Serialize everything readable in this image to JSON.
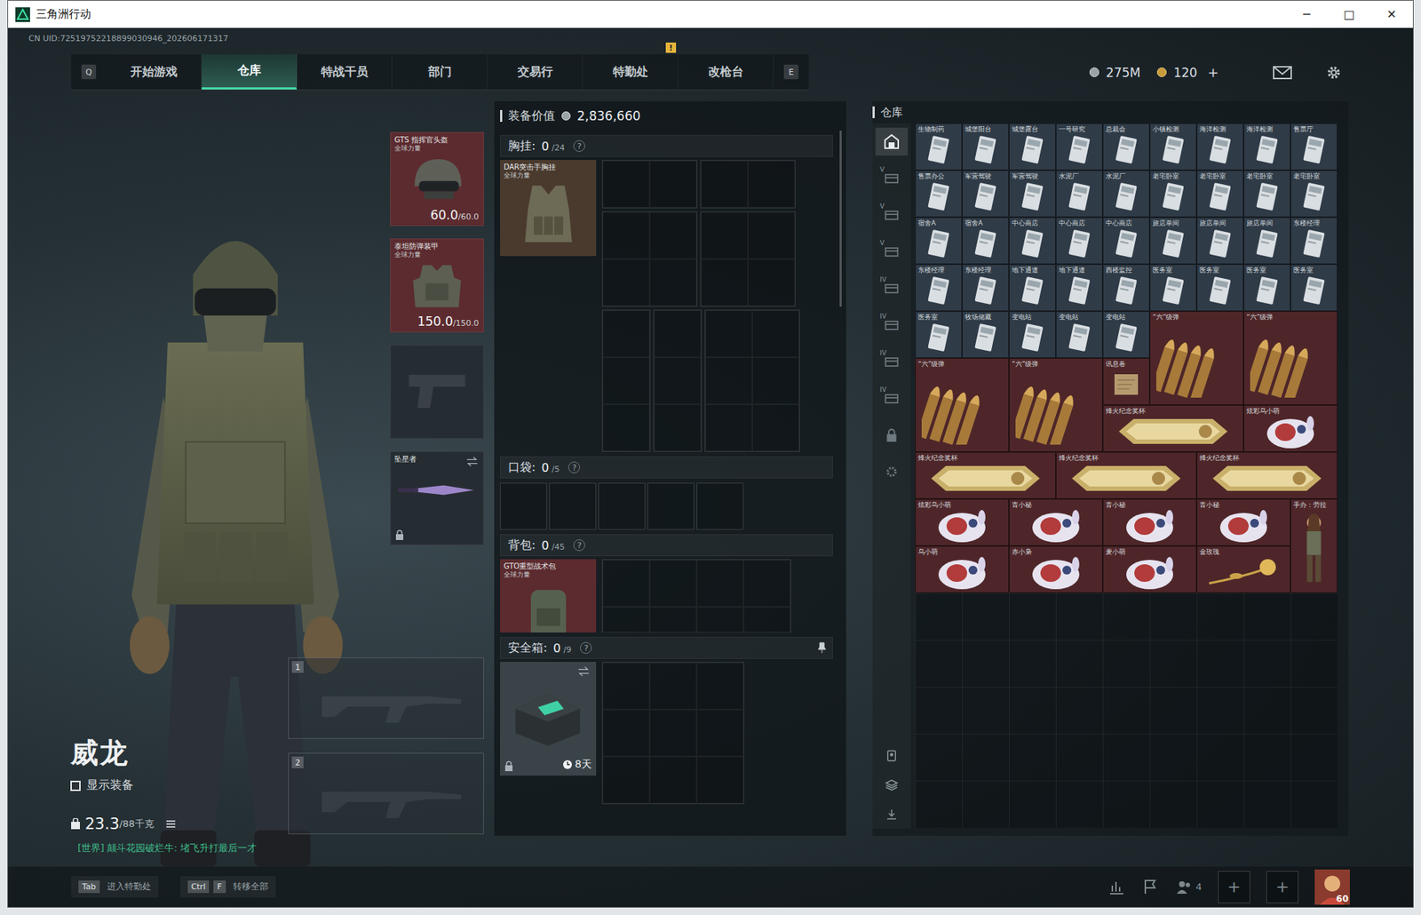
{
  "window": {
    "title": "三角洲行动",
    "controls": [
      "─",
      "□",
      "✕"
    ]
  },
  "uid": "CN UID:72519752218899030946_202606171317",
  "nav": {
    "left_key": "Q",
    "right_key": "E",
    "alert_mark": "!",
    "tabs": [
      {
        "label": "开始游戏",
        "selected": false,
        "alert": false
      },
      {
        "label": "仓库",
        "selected": true,
        "alert": false
      },
      {
        "label": "特战干员",
        "selected": false,
        "alert": false
      },
      {
        "label": "部门",
        "selected": false,
        "alert": false
      },
      {
        "label": "交易行",
        "selected": false,
        "alert": false
      },
      {
        "label": "特勤处",
        "selected": false,
        "alert": true
      },
      {
        "label": "改枪台",
        "selected": false,
        "alert": false
      }
    ]
  },
  "currency": {
    "coins": "275M",
    "tickets": "120",
    "topup": "+"
  },
  "operator": {
    "name": "威龙",
    "show_gear": {
      "label": "显示装备",
      "checked": false
    },
    "weight": "23.3",
    "weight_max": "/88千克",
    "chat": "[世界] 颠斗花园破烂牛: 堵飞升打最后一才"
  },
  "gear_slots": [
    {
      "kind": "helmet",
      "name": "GTS 指挥官头盔",
      "tag": "全球力量",
      "durability": "60.0",
      "max": "/60.0",
      "color": "#5c2b2f",
      "locked": false
    },
    {
      "kind": "armor",
      "name": "泰坦防弹装甲",
      "tag": "全球力量",
      "durability": "150.0",
      "max": "/150.0",
      "color": "#5c2b2f",
      "locked": false
    },
    {
      "kind": "pistol",
      "color": "#262d32",
      "locked": false
    },
    {
      "kind": "melee",
      "name": "坠星者",
      "color": "#262d32",
      "locked": true
    }
  ],
  "weapon_slots": [
    {
      "number": "1"
    },
    {
      "number": "2"
    }
  ],
  "loadout": {
    "value_label": "装备价值",
    "value": "2,836,660",
    "help": "?",
    "sections": [
      {
        "kind": "rig",
        "label": "胸挂:",
        "count": "0",
        "capacity": "/24",
        "item": {
          "name": "DAR突击手胸挂",
          "tag": "全球力量",
          "color": "#4a3a2e"
        }
      },
      {
        "kind": "pocket",
        "label": "口袋:",
        "count": "0",
        "capacity": "/5"
      },
      {
        "kind": "backpack",
        "label": "背包:",
        "count": "0",
        "capacity": "/45",
        "item": {
          "name": "GTO重型战术包",
          "tag": "全球力量",
          "color": "#5c2b2f"
        }
      },
      {
        "kind": "case",
        "label": "安全箱:",
        "count": "0",
        "capacity": "/9",
        "timer": "8天",
        "locked": true,
        "pinned": true
      }
    ]
  },
  "stash": {
    "title": "仓库",
    "sidebar": [
      {
        "kind": "home",
        "selected": true
      },
      {
        "kind": "tier",
        "label": "V",
        "selected": false
      },
      {
        "kind": "tier",
        "label": "V",
        "selected": false
      },
      {
        "kind": "tier",
        "label": "V",
        "selected": false
      },
      {
        "kind": "tier",
        "label": "IV",
        "selected": false
      },
      {
        "kind": "tier",
        "label": "IV",
        "selected": false
      },
      {
        "kind": "tier",
        "label": "IV",
        "selected": false
      },
      {
        "kind": "tier",
        "label": "IV",
        "selected": false
      },
      {
        "kind": "lock",
        "selected": false
      },
      {
        "kind": "gear",
        "selected": false
      }
    ],
    "items": [
      {
        "label": "生物制药",
        "kind": "keycard",
        "color": "#2f3b47"
      },
      {
        "label": "城堡阳台",
        "kind": "keycard",
        "color": "#2f3b47"
      },
      {
        "label": "城堡露台",
        "kind": "keycard",
        "color": "#2f3b47"
      },
      {
        "label": "一号研究",
        "kind": "keycard",
        "color": "#2f3b47"
      },
      {
        "label": "总裁会",
        "kind": "keycard",
        "color": "#2f3b47"
      },
      {
        "label": "小镇检测",
        "kind": "keycard",
        "color": "#2f3b47"
      },
      {
        "label": "海洋检测",
        "kind": "keycard",
        "color": "#2f3b47"
      },
      {
        "label": "海洋检测",
        "kind": "keycard",
        "color": "#2f3b47"
      },
      {
        "label": "售票厅",
        "kind": "keycard",
        "color": "#2f3b47"
      },
      {
        "label": "售票办公",
        "kind": "keycard",
        "color": "#2f3b47"
      },
      {
        "label": "军营驾驶",
        "kind": "keycard",
        "color": "#2f3b47"
      },
      {
        "label": "军营驾驶",
        "kind": "keycard",
        "color": "#2f3b47"
      },
      {
        "label": "水泥厂",
        "kind": "keycard",
        "color": "#2f3b47"
      },
      {
        "label": "水泥厂",
        "kind": "keycard",
        "color": "#2f3b47"
      },
      {
        "label": "老宅卧室",
        "kind": "keycard",
        "color": "#2f3b47"
      },
      {
        "label": "老宅卧室",
        "kind": "keycard",
        "color": "#2f3b47"
      },
      {
        "label": "老宅卧室",
        "kind": "keycard",
        "color": "#2f3b47"
      },
      {
        "label": "老宅卧室",
        "kind": "keycard",
        "color": "#2f3b47"
      },
      {
        "label": "宿舍A",
        "kind": "keycard",
        "color": "#2f3b47"
      },
      {
        "label": "宿舍A",
        "kind": "keycard",
        "color": "#2f3b47"
      },
      {
        "label": "中心商店",
        "kind": "keycard",
        "color": "#2f3b47"
      },
      {
        "label": "中心商店",
        "kind": "keycard",
        "color": "#2f3b47"
      },
      {
        "label": "中心商店",
        "kind": "keycard",
        "color": "#2f3b47"
      },
      {
        "label": "旅店单间",
        "kind": "keycard",
        "color": "#2f3b47"
      },
      {
        "label": "旅店单间",
        "kind": "keycard",
        "color": "#2f3b47"
      },
      {
        "label": "旅店单间",
        "kind": "keycard",
        "color": "#2f3b47"
      },
      {
        "label": "东楼经理",
        "kind": "keycard",
        "color": "#2f3b47"
      },
      {
        "label": "东楼经理",
        "kind": "keycard",
        "color": "#2f3b47"
      },
      {
        "label": "东楼经理",
        "kind": "keycard",
        "color": "#2f3b47"
      },
      {
        "label": "地下通道",
        "kind": "keycard",
        "color": "#2f3b47"
      },
      {
        "label": "地下通道",
        "kind": "keycard",
        "color": "#2f3b47"
      },
      {
        "label": "西楼监控",
        "kind": "keycard",
        "color": "#2f3b47"
      },
      {
        "label": "医务室",
        "kind": "keycard",
        "color": "#2f3b47"
      },
      {
        "label": "医务室",
        "kind": "keycard",
        "color": "#2f3b47"
      },
      {
        "label": "医务室",
        "kind": "keycard",
        "color": "#2f3b47"
      },
      {
        "label": "医务室",
        "kind": "keycard",
        "color": "#2f3b47"
      },
      {
        "label": "医务室",
        "kind": "keycard",
        "color": "#2f3b47"
      },
      {
        "label": "牧场储藏",
        "kind": "keycard",
        "color": "#2f3b47"
      },
      {
        "label": "变电站",
        "kind": "keycard",
        "color": "#2f3b47"
      },
      {
        "label": "变电站",
        "kind": "keycard",
        "color": "#2f3b47"
      },
      {
        "label": "变电站",
        "kind": "keycard",
        "color": "#2f3b47"
      },
      {
        "label": "“六”级弹",
        "kind": "ammo",
        "color": "#4e2629"
      },
      {
        "label": "“六”级弹",
        "kind": "ammo",
        "color": "#4e2629"
      },
      {
        "label": "“六”级弹",
        "kind": "ammo",
        "color": "#4e2629"
      },
      {
        "label": "“六”级弹",
        "kind": "ammo",
        "color": "#4e2629"
      },
      {
        "label": "讯息卷",
        "kind": "scroll",
        "color": "#4e2629"
      },
      {
        "label": "烽火纪念奖杯",
        "kind": "trophy",
        "color": "#4e2629"
      },
      {
        "label": "炫彩乌小萌",
        "kind": "plush",
        "color": "#4e2629"
      },
      {
        "label": "烽火纪念奖杯",
        "kind": "trophy",
        "color": "#4e2629"
      },
      {
        "label": "烽火纪念奖杯",
        "kind": "trophy",
        "color": "#4e2629"
      },
      {
        "label": "烽火纪念奖杯",
        "kind": "trophy",
        "color": "#4e2629"
      },
      {
        "label": "炫彩乌小萌",
        "kind": "plush",
        "color": "#4e2629"
      },
      {
        "label": "青小秘",
        "kind": "plush",
        "color": "#4e2629"
      },
      {
        "label": "青小秘",
        "kind": "plush",
        "color": "#4e2629"
      },
      {
        "label": "青小秘",
        "kind": "plush",
        "color": "#4e2629"
      },
      {
        "label": "手办：劳拉",
        "kind": "figure",
        "color": "#4e2629"
      },
      {
        "label": "乌小萌",
        "kind": "plush",
        "color": "#4e2629"
      },
      {
        "label": "赤小枭",
        "kind": "plush",
        "color": "#4e2629"
      },
      {
        "label": "麦小萌",
        "kind": "plush",
        "color": "#4e2629"
      },
      {
        "label": "金玫瑰",
        "kind": "rose",
        "color": "#4e2629"
      }
    ]
  },
  "bottom_bar": {
    "hints": [
      {
        "keys": [
          "Tab"
        ],
        "label": "进入特勤处"
      },
      {
        "keys": [
          "Ctrl",
          "F"
        ],
        "label": "转移全部"
      }
    ],
    "squad_count": "4",
    "add_slots": [
      "+",
      "+"
    ],
    "level": "60"
  }
}
